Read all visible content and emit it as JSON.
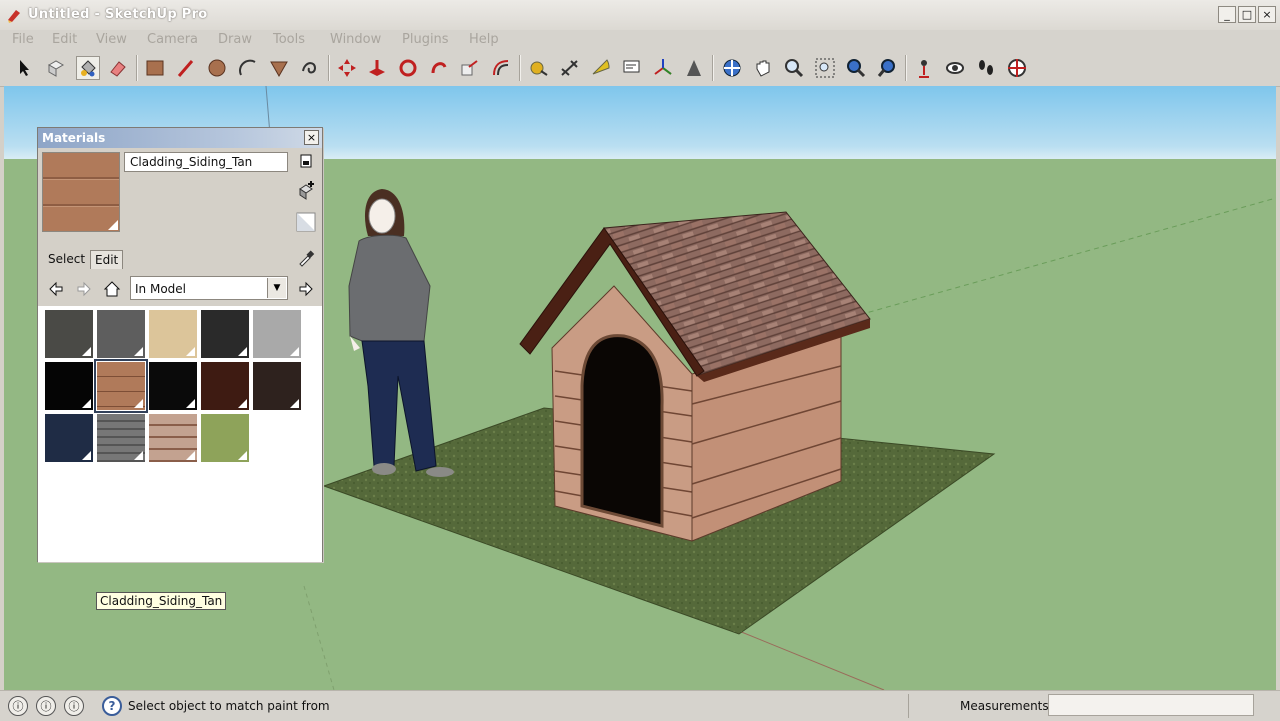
{
  "window": {
    "title": "Untitled - SketchUp Pro",
    "buttons": {
      "minimize": "_",
      "maximize": "□",
      "close": "×"
    }
  },
  "menu": [
    "File",
    "Edit",
    "View",
    "Camera",
    "Draw",
    "Tools",
    "Window",
    "Plugins",
    "Help"
  ],
  "toolbar": {
    "tools": [
      "select-icon",
      "make-component-icon",
      "paint-bucket-icon",
      "eraser-icon",
      "rectangle-icon",
      "line-icon",
      "circle-icon",
      "arc-icon",
      "polygon-icon",
      "freehand-icon",
      "move-icon",
      "push-pull-icon",
      "rotate-icon",
      "follow-me-icon",
      "scale-icon",
      "offset-icon",
      "tape-measure-icon",
      "dimension-icon",
      "protractor-icon",
      "text-icon",
      "axes-icon",
      "3d-text-icon",
      "orbit-icon",
      "pan-icon",
      "zoom-icon",
      "zoom-window-icon",
      "zoom-extents-icon",
      "previous-view-icon",
      "position-camera-icon",
      "look-around-icon",
      "walk-icon",
      "section-plane-icon"
    ],
    "active_tool": "paint-bucket-icon"
  },
  "materials_panel": {
    "title": "Materials",
    "close_label": "×",
    "current_material": "Cladding_Siding_Tan",
    "tabs": [
      "Select",
      "Edit"
    ],
    "selected_tab": "Select",
    "library": "In Model",
    "swatches": [
      {
        "name": "dark-stone",
        "color": "#4a4a46"
      },
      {
        "name": "gray",
        "color": "#5e5e5e"
      },
      {
        "name": "tan",
        "color": "#dcc59a"
      },
      {
        "name": "charcoal",
        "color": "#2a2a2a"
      },
      {
        "name": "light-gray",
        "color": "#a9a9a9"
      },
      {
        "name": "black",
        "color": "#050505"
      },
      {
        "name": "Cladding_Siding_Tan",
        "color": "#b07a5a"
      },
      {
        "name": "black-2",
        "color": "#0a0a0a"
      },
      {
        "name": "dark-brown",
        "color": "#3e1b12"
      },
      {
        "name": "dark-brown-2",
        "color": "#2e221e"
      },
      {
        "name": "navy",
        "color": "#1f2c45"
      },
      {
        "name": "shingle-gray",
        "color": "#6b6b6b"
      },
      {
        "name": "siding-stripe",
        "color": "#c3a290"
      },
      {
        "name": "grass",
        "color": "#8ea35a"
      }
    ],
    "selected_swatch": "Cladding_Siding_Tan",
    "tooltip": "Cladding_Siding_Tan"
  },
  "status": {
    "message": "Select object to match paint from",
    "measurements_label": "Measurements",
    "measurements_value": ""
  },
  "colors": {
    "sky_top": "#7fc6ec",
    "sky_bottom": "#d7ecf4",
    "ground": "#93b883",
    "panel_title": "#8ea5c7"
  }
}
